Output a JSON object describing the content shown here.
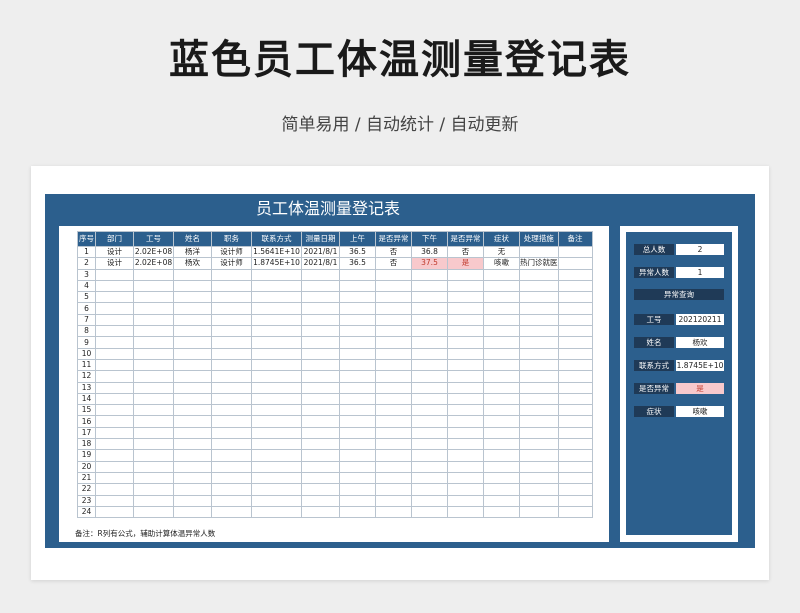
{
  "header": {
    "title": "蓝色员工体温测量登记表",
    "subtitle": "简单易用 / 自动统计 / 自动更新"
  },
  "sheet": {
    "title": "员工体温测量登记表",
    "columns": [
      "序号",
      "部门",
      "工号",
      "姓名",
      "职务",
      "联系方式",
      "测量日期",
      "上午",
      "是否异常",
      "下午",
      "是否异常",
      "症状",
      "处理措施",
      "备注"
    ],
    "rows": [
      [
        "1",
        "设计",
        "2.02E+08",
        "杨洋",
        "设计师",
        "1.5641E+10",
        "2021/8/1",
        "36.5",
        "否",
        "36.8",
        "否",
        "无",
        "",
        ""
      ],
      [
        "2",
        "设计",
        "2.02E+08",
        "杨欢",
        "设计师",
        "1.8745E+10",
        "2021/8/1",
        "36.5",
        "否",
        "37.5",
        "是",
        "咳嗽",
        "热门诊就医",
        ""
      ],
      [
        "3",
        "",
        "",
        "",
        "",
        "",
        "",
        "",
        "",
        "",
        "",
        "",
        "",
        ""
      ],
      [
        "4",
        "",
        "",
        "",
        "",
        "",
        "",
        "",
        "",
        "",
        "",
        "",
        "",
        ""
      ],
      [
        "5",
        "",
        "",
        "",
        "",
        "",
        "",
        "",
        "",
        "",
        "",
        "",
        "",
        ""
      ],
      [
        "6",
        "",
        "",
        "",
        "",
        "",
        "",
        "",
        "",
        "",
        "",
        "",
        "",
        ""
      ],
      [
        "7",
        "",
        "",
        "",
        "",
        "",
        "",
        "",
        "",
        "",
        "",
        "",
        "",
        ""
      ],
      [
        "8",
        "",
        "",
        "",
        "",
        "",
        "",
        "",
        "",
        "",
        "",
        "",
        "",
        ""
      ],
      [
        "9",
        "",
        "",
        "",
        "",
        "",
        "",
        "",
        "",
        "",
        "",
        "",
        "",
        ""
      ],
      [
        "10",
        "",
        "",
        "",
        "",
        "",
        "",
        "",
        "",
        "",
        "",
        "",
        "",
        ""
      ],
      [
        "11",
        "",
        "",
        "",
        "",
        "",
        "",
        "",
        "",
        "",
        "",
        "",
        "",
        ""
      ],
      [
        "12",
        "",
        "",
        "",
        "",
        "",
        "",
        "",
        "",
        "",
        "",
        "",
        "",
        ""
      ],
      [
        "13",
        "",
        "",
        "",
        "",
        "",
        "",
        "",
        "",
        "",
        "",
        "",
        "",
        ""
      ],
      [
        "14",
        "",
        "",
        "",
        "",
        "",
        "",
        "",
        "",
        "",
        "",
        "",
        "",
        ""
      ],
      [
        "15",
        "",
        "",
        "",
        "",
        "",
        "",
        "",
        "",
        "",
        "",
        "",
        "",
        ""
      ],
      [
        "16",
        "",
        "",
        "",
        "",
        "",
        "",
        "",
        "",
        "",
        "",
        "",
        "",
        ""
      ],
      [
        "17",
        "",
        "",
        "",
        "",
        "",
        "",
        "",
        "",
        "",
        "",
        "",
        "",
        ""
      ],
      [
        "18",
        "",
        "",
        "",
        "",
        "",
        "",
        "",
        "",
        "",
        "",
        "",
        "",
        ""
      ],
      [
        "19",
        "",
        "",
        "",
        "",
        "",
        "",
        "",
        "",
        "",
        "",
        "",
        "",
        ""
      ],
      [
        "20",
        "",
        "",
        "",
        "",
        "",
        "",
        "",
        "",
        "",
        "",
        "",
        "",
        ""
      ],
      [
        "21",
        "",
        "",
        "",
        "",
        "",
        "",
        "",
        "",
        "",
        "",
        "",
        "",
        ""
      ],
      [
        "22",
        "",
        "",
        "",
        "",
        "",
        "",
        "",
        "",
        "",
        "",
        "",
        "",
        ""
      ],
      [
        "23",
        "",
        "",
        "",
        "",
        "",
        "",
        "",
        "",
        "",
        "",
        "",
        "",
        ""
      ],
      [
        "24",
        "",
        "",
        "",
        "",
        "",
        "",
        "",
        "",
        "",
        "",
        "",
        "",
        ""
      ]
    ],
    "abnormal_cells": [
      [
        1,
        9
      ],
      [
        1,
        10
      ]
    ],
    "note": "备注：R列有公式，辅助计算体温异常人数"
  },
  "summary": {
    "total_label": "总人数",
    "total_value": "2",
    "abnormal_label": "异常人数",
    "abnormal_value": "1",
    "query_button": "异常查询",
    "id_label": "工号",
    "id_value": "202120211",
    "name_label": "姓名",
    "name_value": "杨欢",
    "contact_label": "联系方式",
    "contact_value": "1.8745E+10",
    "is_abnormal_label": "是否异常",
    "is_abnormal_value": "是",
    "symptom_label": "症状",
    "symptom_value": "咳嗽"
  },
  "colors": {
    "frame_blue": "#2c5f8d",
    "label_dark": "#1f3a57",
    "abnormal_fill": "#f8c9cc",
    "abnormal_text": "#c0392b"
  }
}
